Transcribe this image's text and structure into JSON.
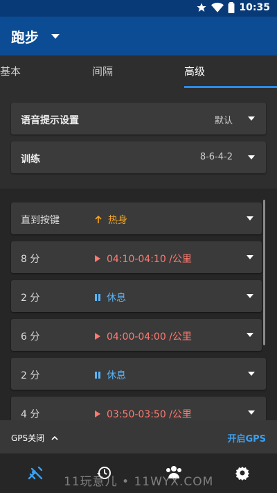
{
  "status": {
    "time": "10:35"
  },
  "appbar": {
    "title": "跑步"
  },
  "tabs": [
    {
      "label": "基本"
    },
    {
      "label": "间隔"
    },
    {
      "label": "高级"
    }
  ],
  "settings": {
    "voice": {
      "label": "语音提示设置",
      "value": "默认"
    },
    "workout": {
      "label": "训练",
      "value": "8-6-4-2"
    }
  },
  "steps": [
    {
      "duration": "直到按键",
      "icon": "up-arrow-icon",
      "text": "热身"
    },
    {
      "duration": "8 分",
      "icon": "play-icon",
      "text": "04:10-04:10 /公里"
    },
    {
      "duration": "2 分",
      "icon": "pause-icon",
      "text": "休息"
    },
    {
      "duration": "6 分",
      "icon": "play-icon",
      "text": "04:00-04:00 /公里"
    },
    {
      "duration": "2 分",
      "icon": "pause-icon",
      "text": "休息"
    },
    {
      "duration": "4 分",
      "icon": "play-icon",
      "text": "03:50-03:50 /公里"
    }
  ],
  "gps": {
    "off_label": "GPS关闭",
    "on_button": "开启GPS"
  },
  "watermark": "11玩意儿 • 11WYX.COM",
  "colors": {
    "appbar": "#0b4c95",
    "accent": "#2b8be6",
    "warmup": "#f5a623",
    "run": "#ff7a70",
    "rest": "#5cb3f5"
  }
}
